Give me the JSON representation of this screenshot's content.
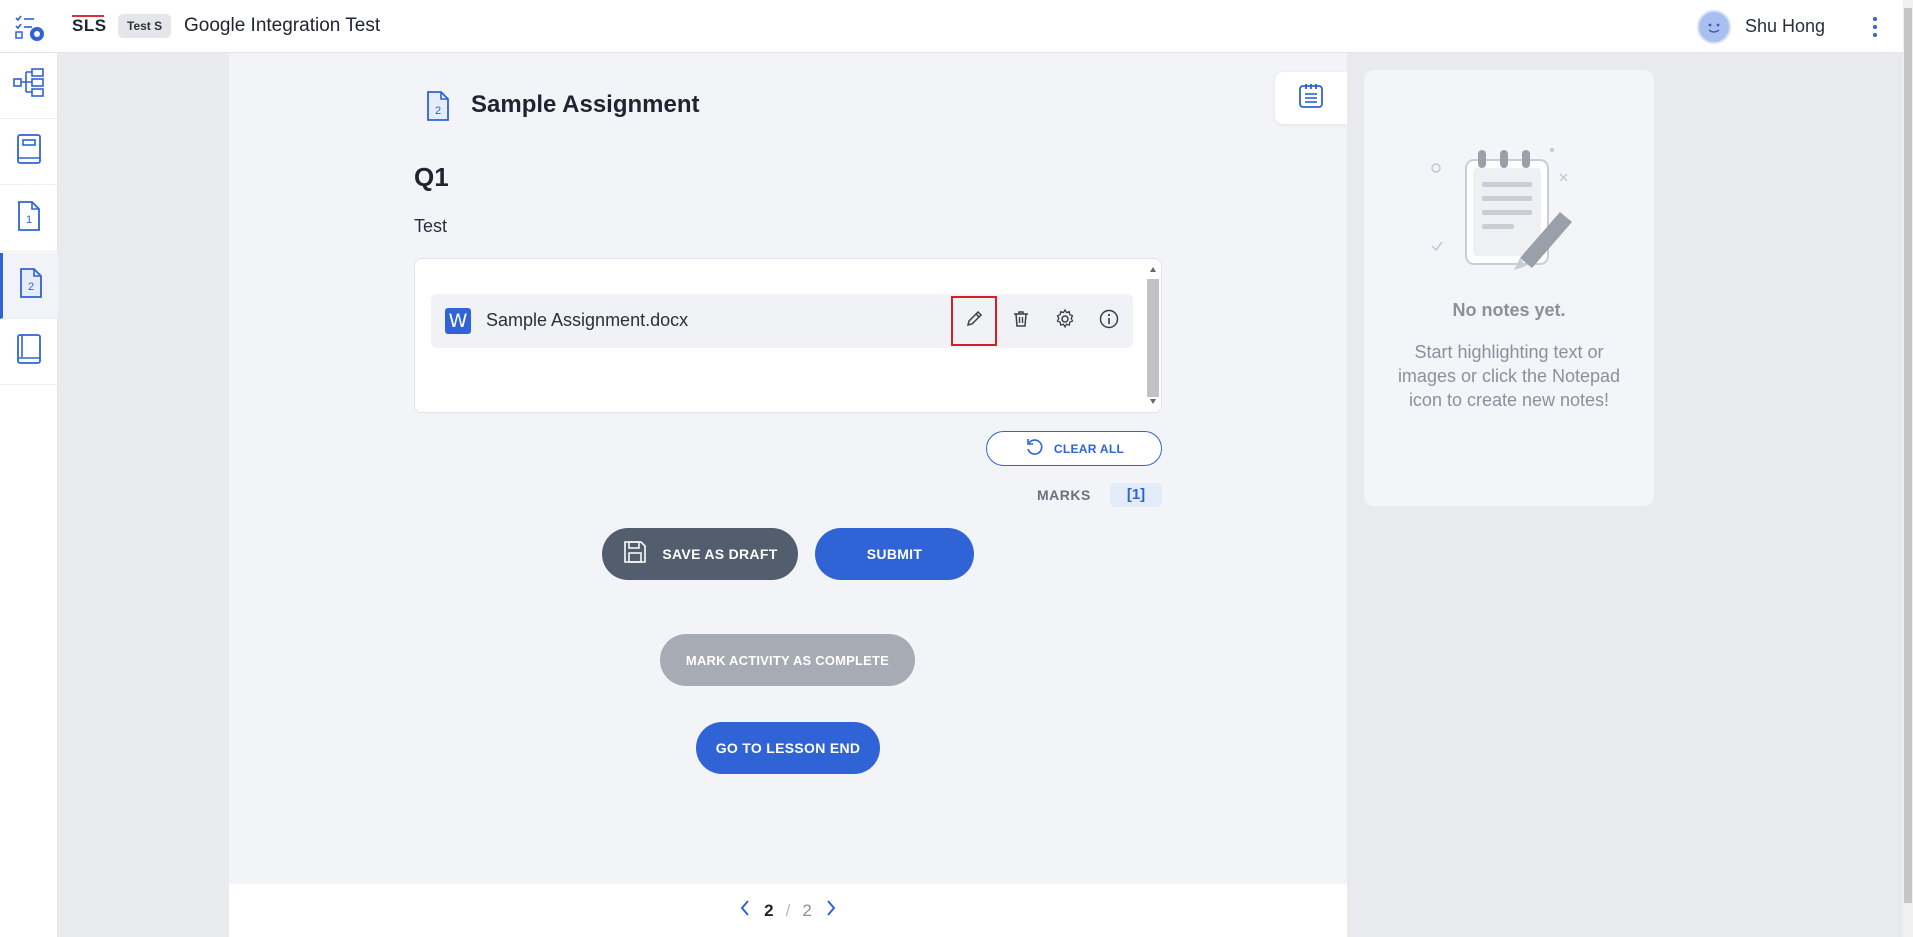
{
  "header": {
    "logo": "SLS",
    "class_badge": "Test S",
    "lesson_title": "Google Integration Test",
    "user_name": "Shu Hong"
  },
  "sidebar": {
    "items": [
      {
        "name": "lesson-map",
        "icon": "tree-map-icon"
      },
      {
        "name": "lesson-intro",
        "icon": "book-page-icon"
      },
      {
        "name": "activity-1",
        "icon": "doc-1-icon",
        "number": "1"
      },
      {
        "name": "activity-2",
        "icon": "doc-2-icon",
        "number": "2",
        "active": true
      },
      {
        "name": "lesson-end",
        "icon": "book-end-icon"
      }
    ]
  },
  "main": {
    "activity_number": "2",
    "title": "Sample Assignment",
    "question_label": "Q1",
    "question_text": "Test",
    "file": {
      "type_letter": "W",
      "name": "Sample Assignment.docx"
    },
    "clear_all_label": "CLEAR ALL",
    "marks_label": "MARKS",
    "marks_value": "[1]",
    "save_draft_label": "SAVE AS DRAFT",
    "submit_label": "SUBMIT",
    "mark_complete_label": "MARK ACTIVITY AS COMPLETE",
    "lesson_end_label": "GO TO LESSON END"
  },
  "pager": {
    "current": "2",
    "separator": "/",
    "total": "2"
  },
  "notes": {
    "title": "No notes yet.",
    "description": "Start highlighting text or images or click the Notepad icon to create new notes!"
  },
  "colors": {
    "accent": "#2f63d6",
    "draft": "#525e6e",
    "disabled": "#a7abb3",
    "highlight_border": "#d0202a"
  }
}
